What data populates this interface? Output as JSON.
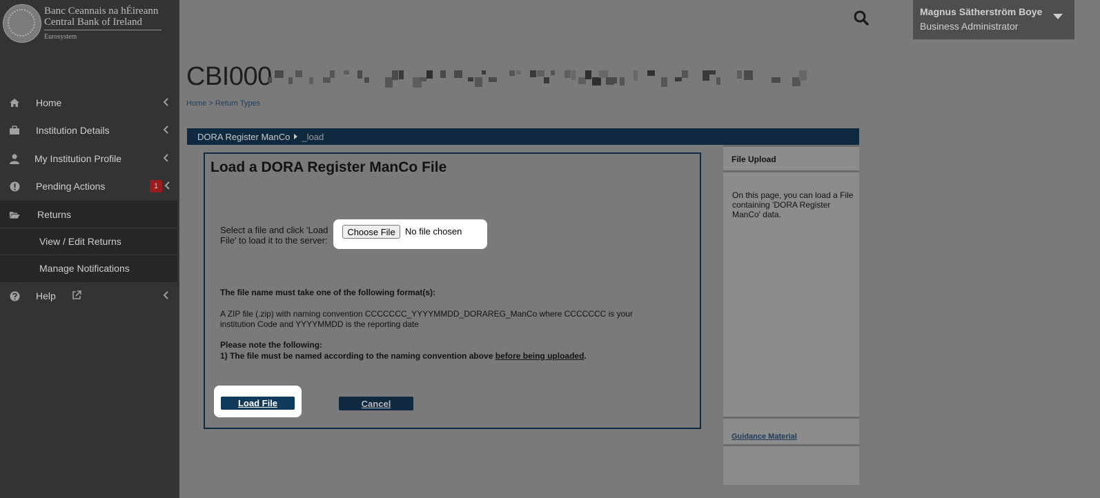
{
  "brand": {
    "line1": "Banc Ceannais na hÉireann",
    "line2": "Central Bank of Ireland",
    "line3": "Eurosystem"
  },
  "sidebar": {
    "items": [
      {
        "label": "Home",
        "icon": "home-icon"
      },
      {
        "label": "Institution Details",
        "icon": "briefcase-icon"
      },
      {
        "label": "My Institution Profile",
        "icon": "user-icon"
      },
      {
        "label": "Pending Actions",
        "icon": "alert-icon",
        "badge": "1"
      },
      {
        "label": "Returns",
        "icon": "folder-open-icon"
      },
      {
        "label": "Help",
        "icon": "question-icon"
      }
    ],
    "returns_sub": [
      {
        "label": "View / Edit Returns"
      },
      {
        "label": "Manage Notifications"
      }
    ]
  },
  "user": {
    "name": "Magnus Sätherström Boye",
    "role": "Business Administrator"
  },
  "page": {
    "title_prefix": "CBI000",
    "breadcrumb_home": "Home",
    "breadcrumb_sep": " > ",
    "breadcrumb_current": "Return Types"
  },
  "bar": {
    "crumb1": "DORA Register ManCo",
    "crumb2": "_load"
  },
  "main": {
    "title": "Load a DORA Register ManCo File",
    "select_label": "Select a file and click 'Load File' to load it to the server:",
    "choose_file": "Choose File",
    "no_file": "No file chosen",
    "format_heading": "The file name must take one of the following format(s):",
    "format_body": "A ZIP file (.zip) with naming convention CCCCCCC_YYYYMMDD_DORAREG_ManCo where CCCCCCC is your institution Code and YYYYMMDD is the reporting date",
    "note_heading": "Please note the following:",
    "note_prefix": "1) The file must be named according to the naming convention above ",
    "note_underlined": "before being uploaded",
    "note_suffix": ".",
    "load_button": "Load File",
    "cancel_button": "Cancel"
  },
  "right_panel": {
    "heading": "File Upload",
    "body": "On this page, you can load a File containing 'DORA Register ManCo' data.",
    "link": "Guidance Material"
  },
  "colors": {
    "sidebar_bg": "#333333",
    "accent_navy": "#0f2a40",
    "badge_red": "#9a1b1b"
  }
}
